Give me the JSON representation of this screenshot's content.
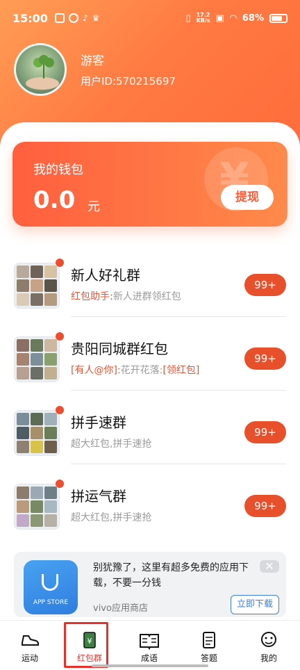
{
  "status": {
    "time": "15:00",
    "net": "17.2\nKB/s",
    "battery": "68%"
  },
  "profile": {
    "name": "游客",
    "id": "用户ID:570215697"
  },
  "wallet": {
    "title": "我的钱包",
    "amount": "0.0",
    "unit": "元",
    "withdraw": "提现"
  },
  "groups": [
    {
      "title": "新人好礼群",
      "prefix": "红包助手:",
      "text": "新人进群领红包",
      "badge": "99+"
    },
    {
      "title": "贵阳同城群红包",
      "prefix": "[有人@你]:",
      "text": "花开花落:",
      "suffix": "[领红包]",
      "badge": "99+"
    },
    {
      "title": "拼手速群",
      "prefix": "",
      "text": "超大红包,拼手速抢",
      "badge": "99+"
    },
    {
      "title": "拼运气群",
      "prefix": "",
      "text": "超大红包,拼手速抢",
      "badge": "99+"
    }
  ],
  "ad": {
    "text": "别犹豫了，这里有超多免费的应用下载，不要一分钱",
    "source": "vivo应用商店",
    "button": "立即下载",
    "icon_label": "APP STORE",
    "close": "✕"
  },
  "nav": {
    "items": [
      "运动",
      "红包群",
      "成语",
      "答题",
      "我的"
    ],
    "active": 1
  }
}
